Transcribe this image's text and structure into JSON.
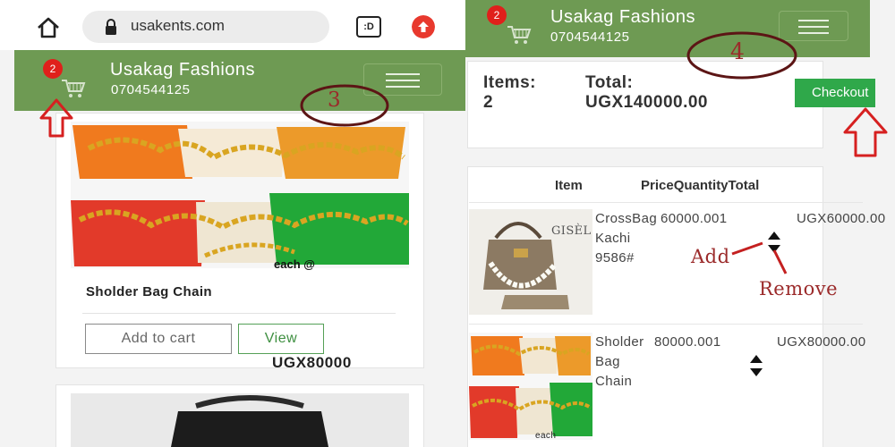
{
  "browser": {
    "url": "usakents.com",
    "tabs_label": ":D"
  },
  "shop": {
    "name": "Usakag Fashions",
    "phone": "0704544125",
    "cart_count": "2"
  },
  "product": {
    "title": "Sholder Bag Chain",
    "add_to_cart_label": "Add to cart",
    "view_label": "View",
    "price": "UGX80000",
    "image_caption": "each @"
  },
  "cart_summary": {
    "items_label": "Items:",
    "items_count": "2",
    "total_label": "Total:",
    "total_value": "UGX140000.00",
    "checkout_label": "Checkout"
  },
  "cart_table": {
    "headers": [
      "Item",
      "PriceQuantityTotal"
    ],
    "rows": [
      {
        "name_lines": [
          "CrossBag",
          "Kachi",
          "9586#"
        ],
        "price_qty": "60000.001",
        "total": "UGX60000.00",
        "image_brand": "GISÈL"
      },
      {
        "name_lines": [
          "Sholder",
          "Bag",
          "Chain"
        ],
        "price_qty": "80000.001",
        "total": "UGX80000.00",
        "image_caption": "each"
      }
    ]
  },
  "annotations": {
    "step_left": "3",
    "step_right": "4",
    "add_label": "Add",
    "remove_label": "Remove"
  },
  "colors": {
    "header_green": "#6e9a53",
    "checkout_green": "#2fa84a",
    "badge_red": "#e0201b",
    "annotation_red": "#9b2a2a",
    "arrow_red": "#d62020"
  }
}
